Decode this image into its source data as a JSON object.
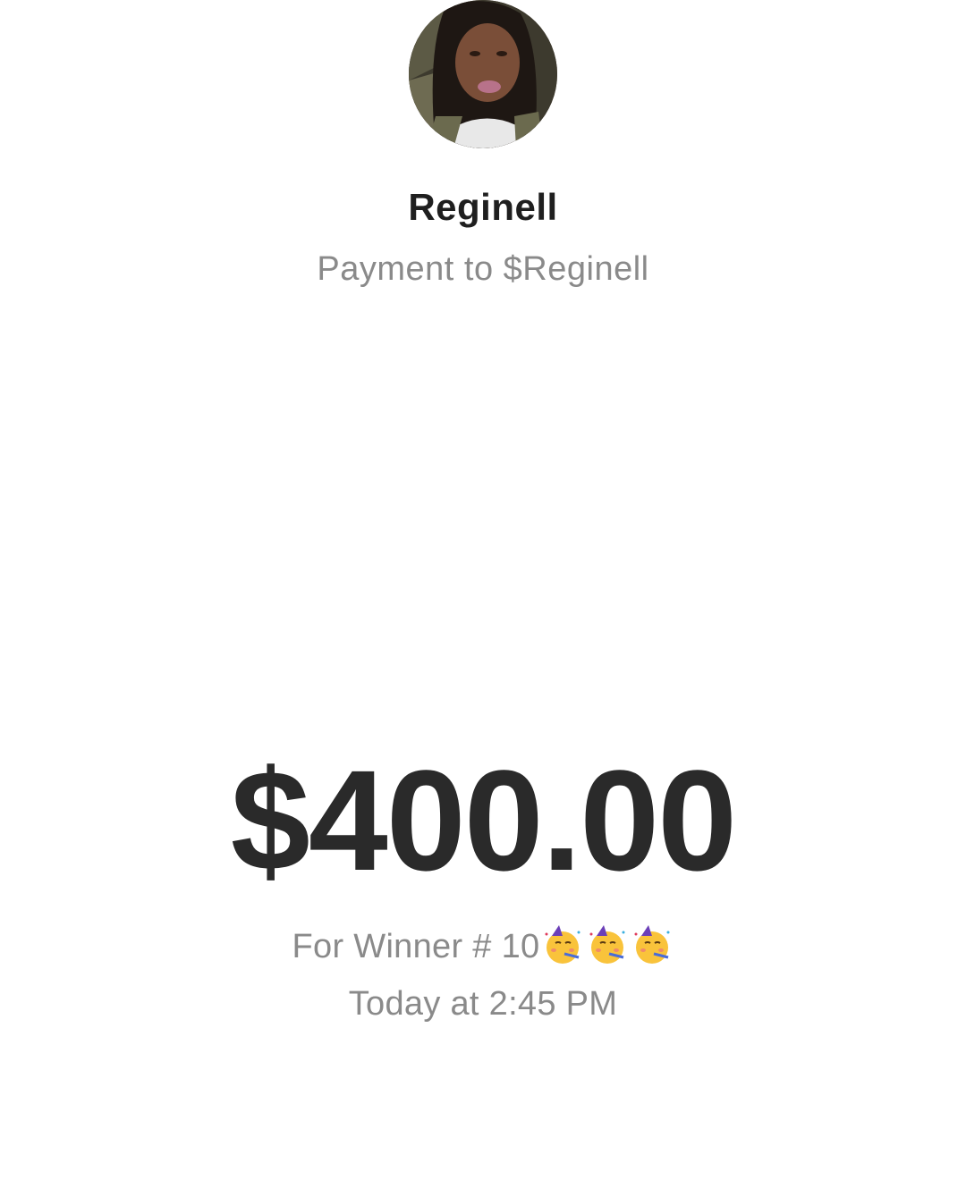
{
  "recipient": {
    "name": "Reginell",
    "subtitle": "Payment to $Reginell"
  },
  "payment": {
    "amount": "$400.00",
    "note": "For Winner # 10",
    "note_emojis": [
      "partying-face-icon",
      "partying-face-icon",
      "partying-face-icon"
    ],
    "timestamp": "Today at 2:45 PM"
  },
  "colors": {
    "background": "#ffffff",
    "name_text": "#1f1f1f",
    "secondary_text": "#8a8a8a",
    "amount_text": "#2a2a2a"
  }
}
